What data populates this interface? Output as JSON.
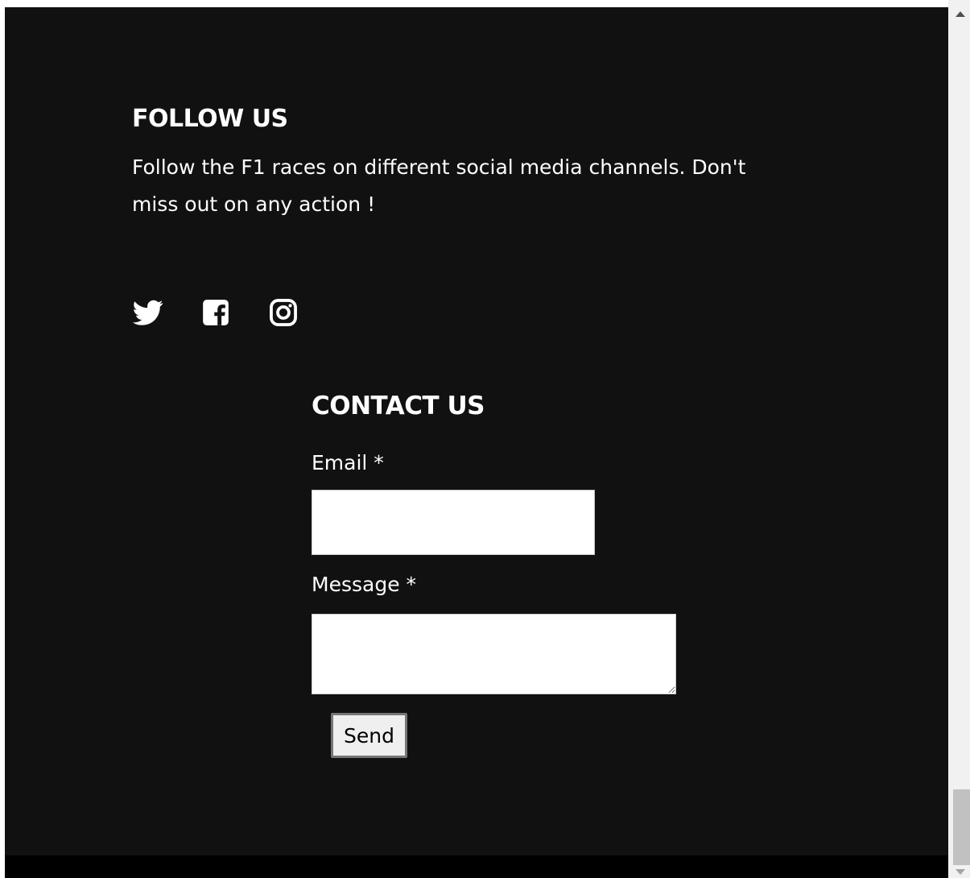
{
  "follow": {
    "title": "FOLLOW US",
    "text": "Follow the F1 races on different social media channels. Don't miss out on any action !",
    "socials": [
      {
        "name": "twitter-icon"
      },
      {
        "name": "facebook-icon"
      },
      {
        "name": "instagram-icon"
      }
    ]
  },
  "contact": {
    "title": "CONTACT US",
    "email_label": "Email *",
    "email_value": "",
    "message_label": "Message *",
    "message_value": "",
    "send_label": "Send"
  },
  "colors": {
    "background": "#111111",
    "footer": "#000000",
    "text": "#ffffff"
  }
}
